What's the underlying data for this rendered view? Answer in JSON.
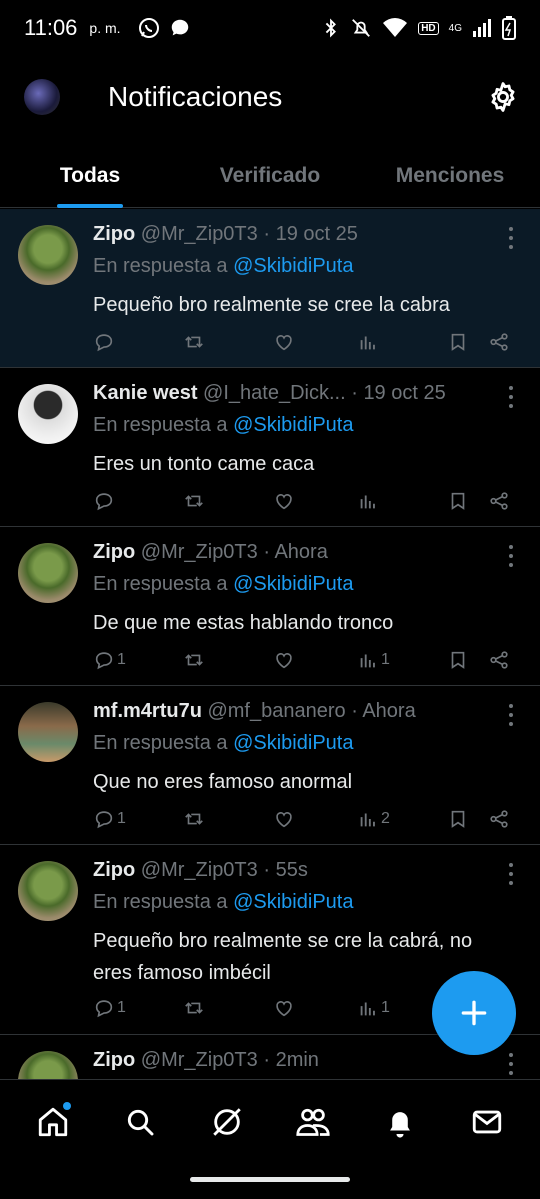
{
  "status_bar": {
    "time": "11:06",
    "ampm": "p. m.",
    "network_badge": "HD",
    "network_type": "4G"
  },
  "header": {
    "title": "Notificaciones"
  },
  "tabs": [
    {
      "label": "Todas",
      "active": true
    },
    {
      "label": "Verificado",
      "active": false
    },
    {
      "label": "Menciones",
      "active": false
    }
  ],
  "notifications": [
    {
      "name": "Zipo",
      "handle": "@Mr_Zip0T3",
      "sep": "·",
      "time": "19 oct 25",
      "reply_prefix": "En respuesta a",
      "mention": "@SkibidiPuta",
      "text": "Pequeño bro realmente se cree la cabra",
      "replies": "",
      "views": "",
      "unread": true
    },
    {
      "name": "Kanie west",
      "handle": "@I_hate_Dick...",
      "sep": "·",
      "time": "19 oct 25",
      "reply_prefix": "En respuesta a",
      "mention": "@SkibidiPuta",
      "text": "Eres un tonto came caca",
      "replies": "",
      "views": ""
    },
    {
      "name": "Zipo",
      "handle": "@Mr_Zip0T3",
      "sep": "·",
      "time": "Ahora",
      "reply_prefix": "En respuesta a",
      "mention": "@SkibidiPuta",
      "text": "De que me estas hablando tronco",
      "replies": "1",
      "views": "1"
    },
    {
      "name": "mf.m4rtu7u",
      "handle": "@mf_bananero",
      "sep": "·",
      "time": "Ahora",
      "reply_prefix": "En respuesta a",
      "mention": "@SkibidiPuta",
      "text": "Que no eres famoso anormal",
      "replies": "1",
      "views": "2"
    },
    {
      "name": "Zipo",
      "handle": "@Mr_Zip0T3",
      "sep": "·",
      "time": "55s",
      "reply_prefix": "En respuesta a",
      "mention": "@SkibidiPuta",
      "text": "Pequeño bro realmente se cre la cabrá, no eres famoso imbécil",
      "replies": "1",
      "views": "1"
    },
    {
      "name": "Zipo",
      "handle": "@Mr_Zip0T3",
      "sep": "·",
      "time": "2min",
      "reply_prefix": "",
      "mention": "",
      "text": "",
      "replies": "",
      "views": ""
    }
  ],
  "colors": {
    "accent": "#1d9bf0",
    "background": "#000000",
    "muted": "#71767b"
  }
}
